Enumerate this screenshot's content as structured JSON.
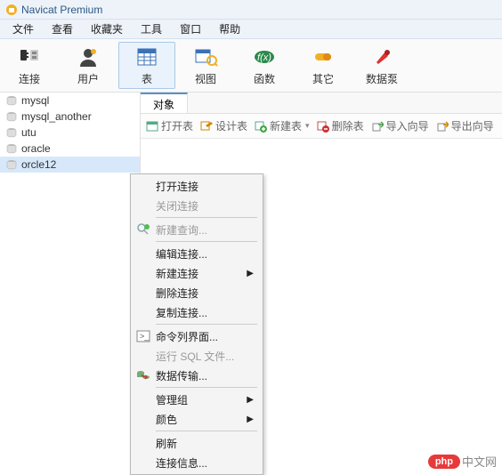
{
  "title": "Navicat Premium",
  "menubar": [
    "文件",
    "查看",
    "收藏夹",
    "工具",
    "窗口",
    "帮助"
  ],
  "toolbar": [
    {
      "label": "连接",
      "icon": "plug"
    },
    {
      "label": "用户",
      "icon": "user"
    },
    {
      "label": "表",
      "icon": "table",
      "active": true
    },
    {
      "label": "视图",
      "icon": "view"
    },
    {
      "label": "函数",
      "icon": "fx"
    },
    {
      "label": "其它",
      "icon": "pill"
    },
    {
      "label": "数据泵",
      "icon": "pump"
    }
  ],
  "tree": [
    {
      "label": "mysql"
    },
    {
      "label": "mysql_another"
    },
    {
      "label": "utu"
    },
    {
      "label": "oracle"
    },
    {
      "label": "orcle12",
      "selected": true
    }
  ],
  "tab": "对象",
  "actions": [
    {
      "label": "打开表",
      "icon": "open"
    },
    {
      "label": "设计表",
      "icon": "design"
    },
    {
      "label": "新建表",
      "icon": "new",
      "dd": true
    },
    {
      "label": "删除表",
      "icon": "delete"
    },
    {
      "label": "导入向导",
      "icon": "import"
    },
    {
      "label": "导出向导",
      "icon": "export"
    }
  ],
  "context_menu": [
    {
      "type": "item",
      "label": "打开连接"
    },
    {
      "type": "item",
      "label": "关闭连接",
      "disabled": true
    },
    {
      "type": "sep"
    },
    {
      "type": "item",
      "label": "新建查询...",
      "disabled": true,
      "icon": "query"
    },
    {
      "type": "sep"
    },
    {
      "type": "item",
      "label": "编辑连接..."
    },
    {
      "type": "item",
      "label": "新建连接",
      "sub": true
    },
    {
      "type": "item",
      "label": "删除连接"
    },
    {
      "type": "item",
      "label": "复制连接..."
    },
    {
      "type": "sep"
    },
    {
      "type": "item",
      "label": "命令列界面...",
      "icon": "cli"
    },
    {
      "type": "item",
      "label": "运行 SQL 文件...",
      "disabled": true
    },
    {
      "type": "item",
      "label": "数据传输...",
      "icon": "transfer"
    },
    {
      "type": "sep"
    },
    {
      "type": "item",
      "label": "管理组",
      "sub": true
    },
    {
      "type": "item",
      "label": "颜色",
      "sub": true
    },
    {
      "type": "sep"
    },
    {
      "type": "item",
      "label": "刷新"
    },
    {
      "type": "item",
      "label": "连接信息..."
    }
  ],
  "watermark": {
    "badge": "php",
    "text": "中文网"
  }
}
